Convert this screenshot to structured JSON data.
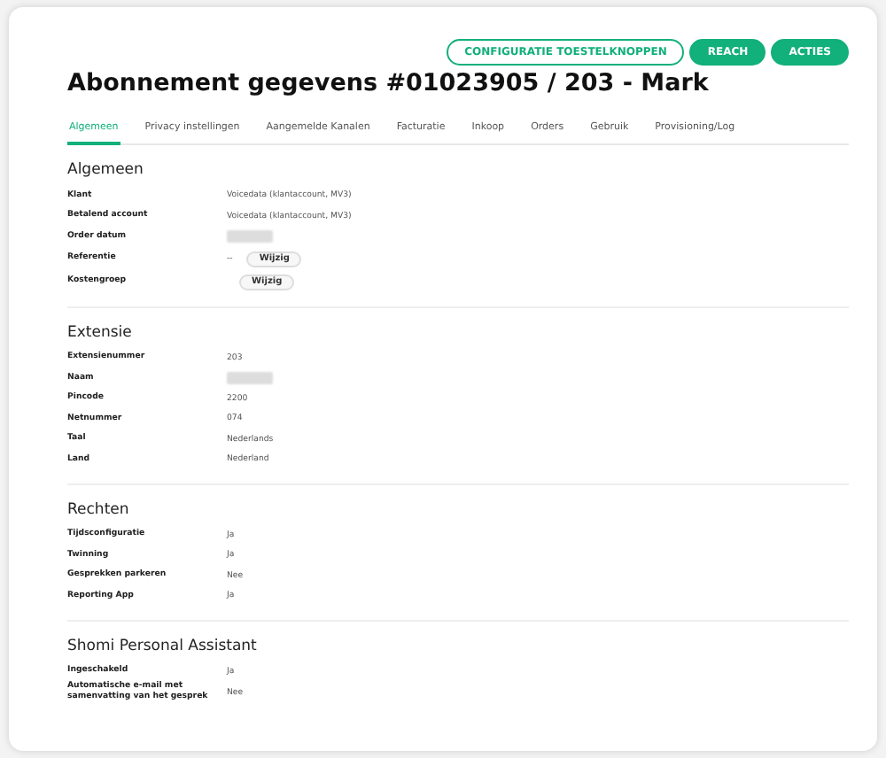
{
  "actions": [
    {
      "label": "CONFIGURATIE TOESTELKNOPPEN",
      "kind": "outline"
    },
    {
      "label": "REACH",
      "kind": "solid"
    },
    {
      "label": "ACTIES",
      "kind": "solid"
    }
  ],
  "title": "Abonnement gegevens #01023905 / 203 - Mark",
  "tabs": [
    {
      "label": "Algemeen",
      "selected": true
    },
    {
      "label": "Privacy instellingen",
      "selected": false
    },
    {
      "label": "Aangemelde Kanalen",
      "selected": false
    },
    {
      "label": "Facturatie",
      "selected": false
    },
    {
      "label": "Inkoop",
      "selected": false
    },
    {
      "label": "Orders",
      "selected": false
    },
    {
      "label": "Gebruik",
      "selected": false
    },
    {
      "label": "Provisioning/Log",
      "selected": false
    }
  ],
  "sections": [
    {
      "heading": "Algemeen",
      "rows": [
        {
          "label": "Klant",
          "kind": "text",
          "value": "Voicedata (klantaccount, MV3)"
        },
        {
          "label": "Betalend account",
          "kind": "text",
          "value": "Voicedata (klantaccount, MV3)"
        },
        {
          "label": "Order datum",
          "kind": "redacted"
        },
        {
          "label": "Referentie",
          "kind": "button",
          "value": "--",
          "button": "Wijzig"
        },
        {
          "label": "Kostengroep",
          "kind": "button",
          "button": "Wijzig"
        }
      ]
    },
    {
      "heading": "Extensie",
      "rows": [
        {
          "label": "Extensienummer",
          "kind": "text",
          "value": "203"
        },
        {
          "label": "Naam",
          "kind": "redacted"
        },
        {
          "label": "Pincode",
          "kind": "text",
          "value": "2200"
        },
        {
          "label": "Netnummer",
          "kind": "text",
          "value": "074"
        },
        {
          "label": "Taal",
          "kind": "text",
          "value": "Nederlands"
        },
        {
          "label": "Land",
          "kind": "text",
          "value": "Nederland"
        }
      ]
    },
    {
      "heading": "Rechten",
      "rows": [
        {
          "label": "Tijdsconfiguratie",
          "kind": "text",
          "value": "Ja"
        },
        {
          "label": "Twinning",
          "kind": "text",
          "value": "Ja"
        },
        {
          "label": "Gesprekken parkeren",
          "kind": "text",
          "value": "Nee"
        },
        {
          "label": "Reporting App",
          "kind": "text",
          "value": "Ja"
        }
      ]
    },
    {
      "heading": "Shomi Personal Assistant",
      "rows": [
        {
          "label": "Ingeschakeld",
          "kind": "text",
          "value": "Ja"
        },
        {
          "label": "Automatische e-mail met samenvatting van het gesprek",
          "kind": "text",
          "value": "Nee"
        }
      ]
    }
  ]
}
